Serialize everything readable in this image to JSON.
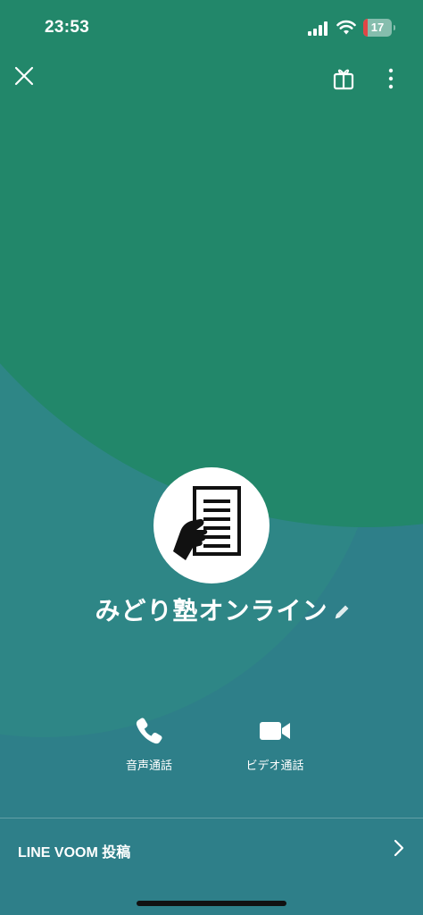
{
  "status_bar": {
    "time": "23:53",
    "battery": "17"
  },
  "profile": {
    "name": "みどり塾オンライン"
  },
  "actions": [
    {
      "label": "音声通話",
      "icon": "phone-icon"
    },
    {
      "label": "ビデオ通話",
      "icon": "video-camera-icon"
    }
  ],
  "voom": {
    "label": "LINE VOOM 投稿"
  },
  "colors": {
    "top_green": "#22876a",
    "teal": "#2e7f89",
    "battery_red": "#e04646"
  }
}
